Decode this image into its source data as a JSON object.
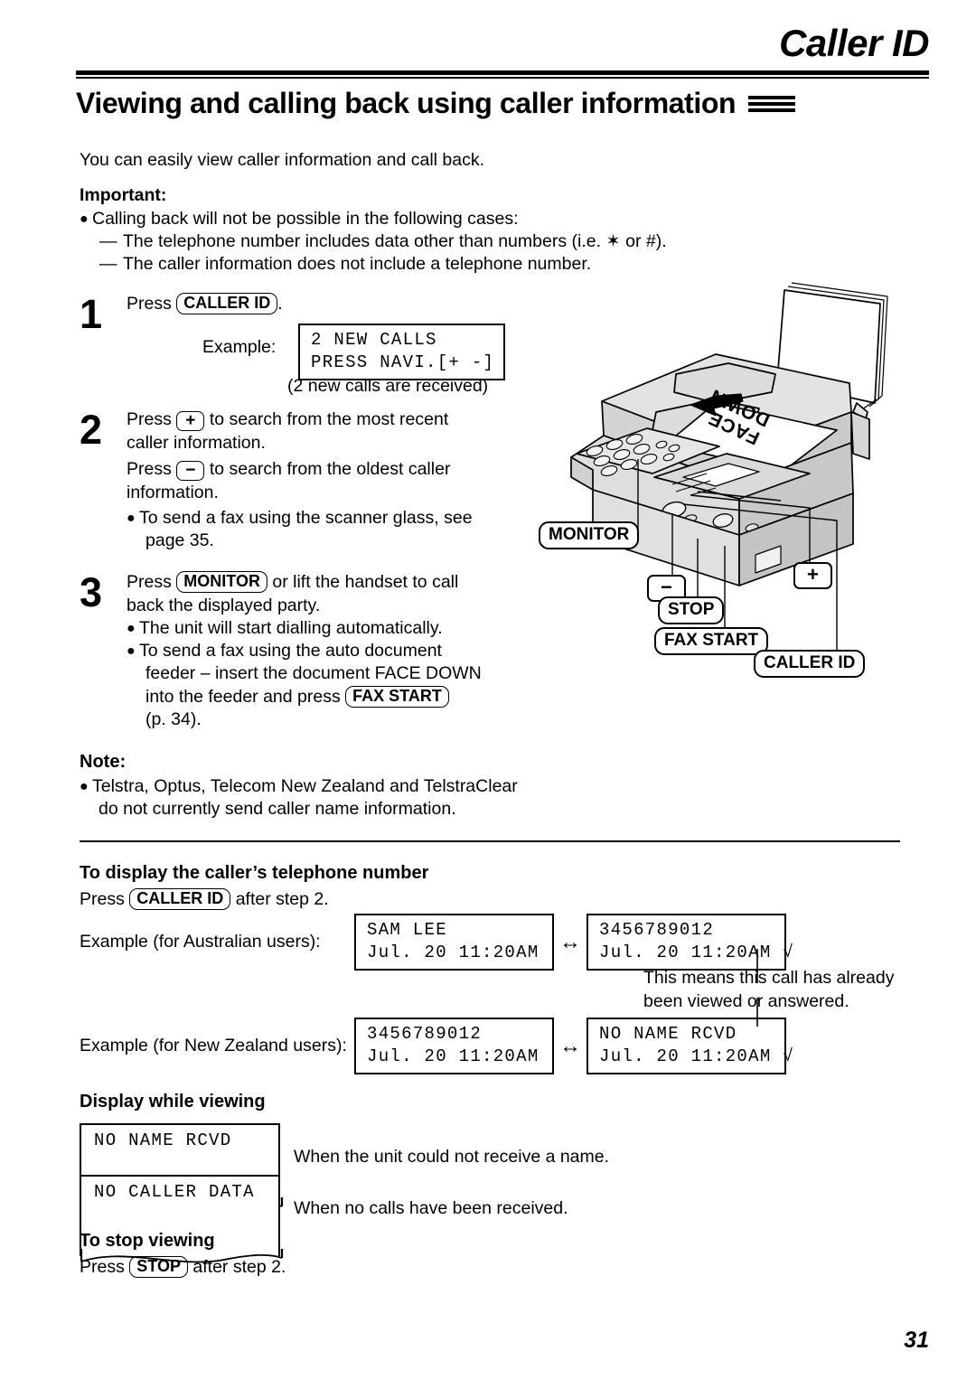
{
  "header": {
    "chapter": "Caller ID",
    "section_title": "Viewing and calling back using caller information"
  },
  "intro": "You can easily view caller information and call back.",
  "important": {
    "heading": "Important:",
    "bullet": "Calling back will not be possible in the following cases:",
    "dashes": [
      "The telephone number includes data other than numbers (i.e. ✶ or #).",
      "The caller information does not include a telephone number."
    ]
  },
  "steps": [
    {
      "num": "1",
      "text_before": "Press",
      "key": "CALLER ID",
      "text_after": ".",
      "example_label": "Example:",
      "lcd_line1": "2 NEW CALLS",
      "lcd_line2": "PRESS NAVI.[+ -]",
      "caption": "(2 new calls are received)"
    },
    {
      "num": "2",
      "line1a": "Press",
      "key_plus": "+",
      "line1b": "to search from the most recent",
      "line2": "caller information.",
      "line3a": "Press",
      "key_minus": "−",
      "line3b": "to search from the oldest caller",
      "line4": "information.",
      "bullet1": "To send a fax using the scanner glass, see",
      "bullet1_cont": "page 35."
    },
    {
      "num": "3",
      "line1a": "Press",
      "key_monitor": "MONITOR",
      "line1b": "or lift the handset to call",
      "line2": "back the displayed party.",
      "bullet1": "The unit will start dialling automatically.",
      "bullet2_l1": "To send a fax using the auto document",
      "bullet2_l2": "feeder – insert the document FACE DOWN",
      "bullet2_l3a": "into the feeder and press",
      "bullet2_key": "FAX START",
      "bullet2_l4": "(p. 34)."
    }
  ],
  "note": {
    "heading": "Note:",
    "bullet_l1": "Telstra, Optus, Telecom New Zealand and TelstraClear",
    "bullet_l2": "do not currently send caller name information."
  },
  "display_number": {
    "heading": "To display the caller’s telephone number",
    "press_before": "Press",
    "press_key": "CALLER ID",
    "press_after": "after step 2.",
    "au_label": "Example (for Australian users):",
    "au_lcd1_line1": "SAM LEE",
    "au_lcd1_line2": "Jul. 20 11:20AM",
    "au_lcd2_line1": "3456789012",
    "au_lcd2_line2": "Jul. 20 11:20AM √",
    "annotation_l1": "This means this call has already",
    "annotation_l2": "been viewed or answered.",
    "nz_label": "Example (for New Zealand users):",
    "nz_lcd1_line1": "3456789012",
    "nz_lcd1_line2": "Jul. 20 11:20AM",
    "nz_lcd2_line1": "NO NAME RCVD",
    "nz_lcd2_line2": "Jul. 20 11:20AM √",
    "arrow": "↔"
  },
  "display_viewing": {
    "heading": "Display while viewing",
    "rows": [
      {
        "lcd": "NO NAME RCVD",
        "desc": "When the unit could not receive a name."
      },
      {
        "lcd": "NO CALLER DATA",
        "desc": "When no calls have been received."
      }
    ]
  },
  "stop_viewing": {
    "heading": "To stop viewing",
    "press_before": "Press",
    "press_key": "STOP",
    "press_after": "after step 2."
  },
  "illustration": {
    "paper_label_line1": "FACE",
    "paper_label_line2": "DOWN",
    "callouts": [
      {
        "name": "monitor",
        "label": "MONITOR"
      },
      {
        "name": "minus",
        "label": "−"
      },
      {
        "name": "stop",
        "label": "STOP"
      },
      {
        "name": "fax-start",
        "label": "FAX START"
      },
      {
        "name": "caller-id",
        "label": "CALLER ID"
      },
      {
        "name": "plus",
        "label": "+"
      }
    ]
  },
  "page_number": "31",
  "colors": {
    "ink": "#000000",
    "paper": "#ffffff",
    "shade": "#e3e3e3",
    "shade_dark": "#cfcfcf"
  }
}
